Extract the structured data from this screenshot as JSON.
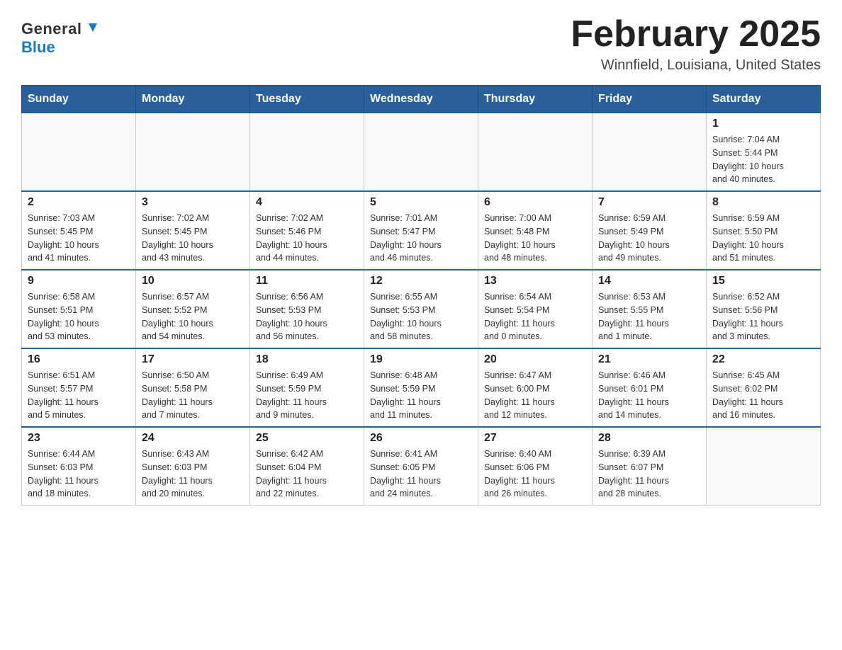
{
  "header": {
    "logo_general": "General",
    "logo_blue": "Blue",
    "title": "February 2025",
    "subtitle": "Winnfield, Louisiana, United States"
  },
  "calendar": {
    "days_of_week": [
      "Sunday",
      "Monday",
      "Tuesday",
      "Wednesday",
      "Thursday",
      "Friday",
      "Saturday"
    ],
    "weeks": [
      {
        "days": [
          {
            "num": "",
            "info": ""
          },
          {
            "num": "",
            "info": ""
          },
          {
            "num": "",
            "info": ""
          },
          {
            "num": "",
            "info": ""
          },
          {
            "num": "",
            "info": ""
          },
          {
            "num": "",
            "info": ""
          },
          {
            "num": "1",
            "info": "Sunrise: 7:04 AM\nSunset: 5:44 PM\nDaylight: 10 hours\nand 40 minutes."
          }
        ]
      },
      {
        "days": [
          {
            "num": "2",
            "info": "Sunrise: 7:03 AM\nSunset: 5:45 PM\nDaylight: 10 hours\nand 41 minutes."
          },
          {
            "num": "3",
            "info": "Sunrise: 7:02 AM\nSunset: 5:45 PM\nDaylight: 10 hours\nand 43 minutes."
          },
          {
            "num": "4",
            "info": "Sunrise: 7:02 AM\nSunset: 5:46 PM\nDaylight: 10 hours\nand 44 minutes."
          },
          {
            "num": "5",
            "info": "Sunrise: 7:01 AM\nSunset: 5:47 PM\nDaylight: 10 hours\nand 46 minutes."
          },
          {
            "num": "6",
            "info": "Sunrise: 7:00 AM\nSunset: 5:48 PM\nDaylight: 10 hours\nand 48 minutes."
          },
          {
            "num": "7",
            "info": "Sunrise: 6:59 AM\nSunset: 5:49 PM\nDaylight: 10 hours\nand 49 minutes."
          },
          {
            "num": "8",
            "info": "Sunrise: 6:59 AM\nSunset: 5:50 PM\nDaylight: 10 hours\nand 51 minutes."
          }
        ]
      },
      {
        "days": [
          {
            "num": "9",
            "info": "Sunrise: 6:58 AM\nSunset: 5:51 PM\nDaylight: 10 hours\nand 53 minutes."
          },
          {
            "num": "10",
            "info": "Sunrise: 6:57 AM\nSunset: 5:52 PM\nDaylight: 10 hours\nand 54 minutes."
          },
          {
            "num": "11",
            "info": "Sunrise: 6:56 AM\nSunset: 5:53 PM\nDaylight: 10 hours\nand 56 minutes."
          },
          {
            "num": "12",
            "info": "Sunrise: 6:55 AM\nSunset: 5:53 PM\nDaylight: 10 hours\nand 58 minutes."
          },
          {
            "num": "13",
            "info": "Sunrise: 6:54 AM\nSunset: 5:54 PM\nDaylight: 11 hours\nand 0 minutes."
          },
          {
            "num": "14",
            "info": "Sunrise: 6:53 AM\nSunset: 5:55 PM\nDaylight: 11 hours\nand 1 minute."
          },
          {
            "num": "15",
            "info": "Sunrise: 6:52 AM\nSunset: 5:56 PM\nDaylight: 11 hours\nand 3 minutes."
          }
        ]
      },
      {
        "days": [
          {
            "num": "16",
            "info": "Sunrise: 6:51 AM\nSunset: 5:57 PM\nDaylight: 11 hours\nand 5 minutes."
          },
          {
            "num": "17",
            "info": "Sunrise: 6:50 AM\nSunset: 5:58 PM\nDaylight: 11 hours\nand 7 minutes."
          },
          {
            "num": "18",
            "info": "Sunrise: 6:49 AM\nSunset: 5:59 PM\nDaylight: 11 hours\nand 9 minutes."
          },
          {
            "num": "19",
            "info": "Sunrise: 6:48 AM\nSunset: 5:59 PM\nDaylight: 11 hours\nand 11 minutes."
          },
          {
            "num": "20",
            "info": "Sunrise: 6:47 AM\nSunset: 6:00 PM\nDaylight: 11 hours\nand 12 minutes."
          },
          {
            "num": "21",
            "info": "Sunrise: 6:46 AM\nSunset: 6:01 PM\nDaylight: 11 hours\nand 14 minutes."
          },
          {
            "num": "22",
            "info": "Sunrise: 6:45 AM\nSunset: 6:02 PM\nDaylight: 11 hours\nand 16 minutes."
          }
        ]
      },
      {
        "days": [
          {
            "num": "23",
            "info": "Sunrise: 6:44 AM\nSunset: 6:03 PM\nDaylight: 11 hours\nand 18 minutes."
          },
          {
            "num": "24",
            "info": "Sunrise: 6:43 AM\nSunset: 6:03 PM\nDaylight: 11 hours\nand 20 minutes."
          },
          {
            "num": "25",
            "info": "Sunrise: 6:42 AM\nSunset: 6:04 PM\nDaylight: 11 hours\nand 22 minutes."
          },
          {
            "num": "26",
            "info": "Sunrise: 6:41 AM\nSunset: 6:05 PM\nDaylight: 11 hours\nand 24 minutes."
          },
          {
            "num": "27",
            "info": "Sunrise: 6:40 AM\nSunset: 6:06 PM\nDaylight: 11 hours\nand 26 minutes."
          },
          {
            "num": "28",
            "info": "Sunrise: 6:39 AM\nSunset: 6:07 PM\nDaylight: 11 hours\nand 28 minutes."
          },
          {
            "num": "",
            "info": ""
          }
        ]
      }
    ]
  }
}
